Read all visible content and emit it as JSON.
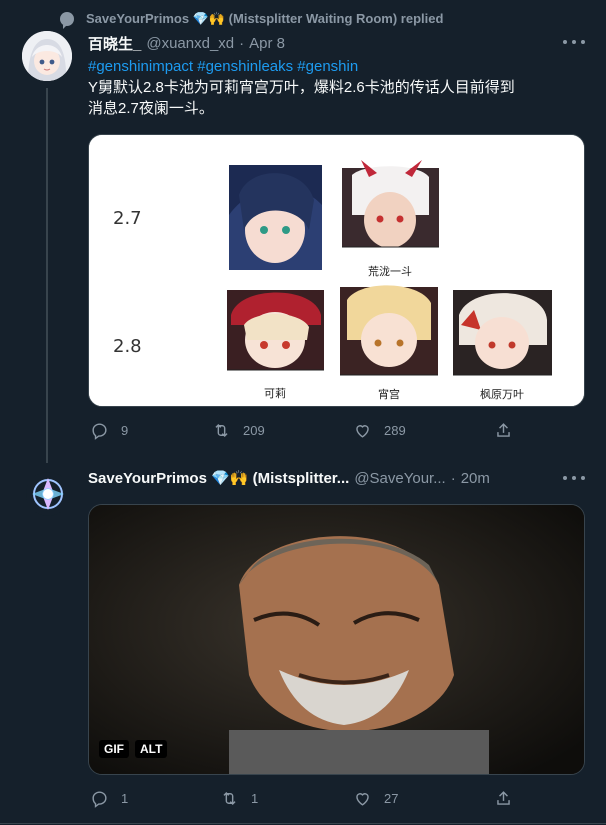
{
  "context": {
    "text": "SaveYourPrimos 💎🙌 (Mistsplitter Waiting Room) replied"
  },
  "tweet1": {
    "display_name": "百晓生_",
    "handle": "@xuanxd_xd",
    "separator": "·",
    "date": "Apr 8",
    "hashtags": "#genshinimpact #genshinleaks #genshin",
    "text_line1": "Y舅默认2.8卡池为可莉宵宫万叶，爆料2.6卡池的传话人目前得到",
    "text_line2": "消息2.7夜阑一斗。",
    "image": {
      "row1_label": "2.7",
      "row2_label": "2.8",
      "char_itto": "荒泷一斗",
      "char_klee": "可莉",
      "char_yoimiya": "宵宫",
      "char_kazuha": "枫原万叶"
    },
    "replies": "9",
    "retweets": "209",
    "likes": "289"
  },
  "tweet2": {
    "display_name": "SaveYourPrimos 💎🙌 (Mistsplitter...",
    "handle": "@SaveYour...",
    "separator": "·",
    "time": "20m",
    "gif_label": "GIF",
    "alt_label": "ALT",
    "replies": "1",
    "retweets": "1",
    "likes": "27"
  },
  "colors": {
    "background": "#15202b",
    "accent": "#1d9bf0",
    "muted": "#8b98a5",
    "border": "#38444d"
  }
}
